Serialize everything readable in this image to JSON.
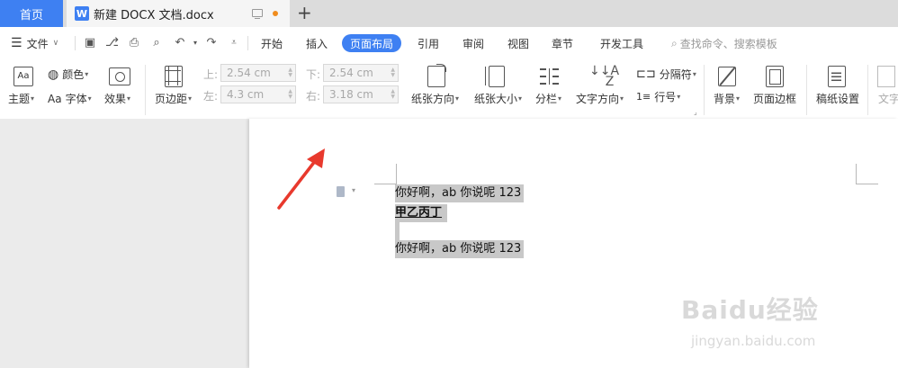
{
  "tabs": {
    "home": "首页",
    "doc": "新建 DOCX 文档.docx",
    "new_tab": "+"
  },
  "menu": {
    "file": "文件",
    "items": [
      "开始",
      "插入",
      "页面布局",
      "引用",
      "审阅",
      "视图",
      "章节",
      "开发工具"
    ],
    "active": "页面布局",
    "search": "查找命令、搜索模板"
  },
  "ribbon": {
    "theme": "主题",
    "color": "颜色",
    "font": "字体",
    "effect": "效果",
    "margin": "页边距",
    "top_label": "上:",
    "top_value": "2.54 cm",
    "bottom_label": "下:",
    "bottom_value": "2.54 cm",
    "left_label": "左:",
    "left_value": "4.3 cm",
    "right_label": "右:",
    "right_value": "3.18 cm",
    "orientation": "纸张方向",
    "size": "纸张大小",
    "columns": "分栏",
    "text_direction": "文字方向",
    "separator": "分隔符",
    "line_number": "行号",
    "background": "背景",
    "page_border": "页面边框",
    "grid_paper": "稿纸设置",
    "text_cut": "文字"
  },
  "document": {
    "lines": [
      "你好啊，ab 你说呢 123",
      "甲乙丙丁",
      "你好啊，ab 你说呢 123"
    ]
  },
  "watermark": {
    "brand": "Baidu经验",
    "url": "jingyan.baidu.com"
  },
  "colors": {
    "accent": "#3e80f2",
    "arrow": "#e8392d",
    "selection": "#c8c8c8",
    "unsaved_dot": "#f08c1d"
  }
}
